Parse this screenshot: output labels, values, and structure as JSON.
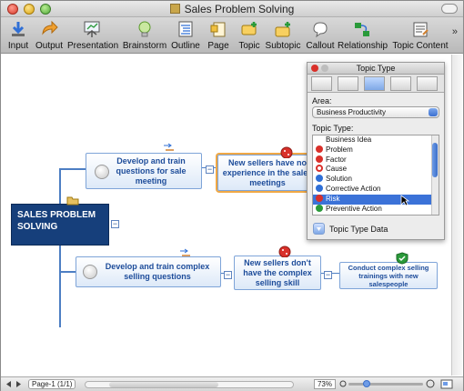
{
  "window": {
    "title": "Sales Problem Solving"
  },
  "toolbar": {
    "items": [
      {
        "label": "Input",
        "icon": "input-icon"
      },
      {
        "label": "Output",
        "icon": "output-icon"
      },
      {
        "label": "Presentation",
        "icon": "presentation-icon"
      },
      {
        "label": "Brainstorm",
        "icon": "brainstorm-icon"
      },
      {
        "label": "Outline",
        "icon": "outline-icon"
      },
      {
        "label": "Page",
        "icon": "page-icon"
      },
      {
        "label": "Topic",
        "icon": "topic-icon"
      },
      {
        "label": "Subtopic",
        "icon": "subtopic-icon"
      },
      {
        "label": "Callout",
        "icon": "callout-icon"
      },
      {
        "label": "Relationship",
        "icon": "relationship-icon"
      },
      {
        "label": "Topic Content",
        "icon": "topic-content-icon"
      }
    ],
    "overflow": "»"
  },
  "map": {
    "central": "SALES PROBLEM SOLVING",
    "topics": {
      "t1": "Develop and train questions for sale meeting",
      "t2": "New sellers have no experience in the sales meetings",
      "t3": "Develop and train complex selling questions",
      "t4": "New sellers don't have the complex selling skill",
      "t5": "Conduct complex selling trainings with new salespeople"
    },
    "collapse_glyph": "−"
  },
  "palette": {
    "title": "Topic Type",
    "area_label": "Area:",
    "area_value": "Business Productivity",
    "topic_type_label": "Topic Type:",
    "types": [
      {
        "label": "Business Idea",
        "color": "#ffffff"
      },
      {
        "label": "Problem",
        "color": "#d9302a"
      },
      {
        "label": "Factor",
        "color": "#d9302a"
      },
      {
        "label": "Cause",
        "color": "#d9302a"
      },
      {
        "label": "Solution",
        "color": "#2f6fd6"
      },
      {
        "label": "Corrective Action",
        "color": "#2f6fd6"
      },
      {
        "label": "Risk",
        "color": "#d9302a"
      },
      {
        "label": "Preventive Action",
        "color": "#2a9a3a"
      }
    ],
    "selected_type": "Risk",
    "topic_type_data": "Topic Type Data"
  },
  "status": {
    "page": "Page-1 (1/1)",
    "zoom": "73%"
  }
}
